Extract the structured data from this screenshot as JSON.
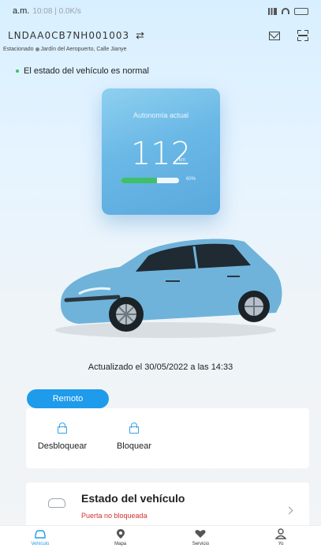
{
  "status_bar": {
    "time": "a.m.",
    "extra": "10:08 | 0.0K/s",
    "signal": ".ıll"
  },
  "header": {
    "vin": "LNDAA0CB7NH001003",
    "switch_glyph": "⇄"
  },
  "location": {
    "text": "Estacionado",
    "address": "Jardín del Aeropuerto, Calle Jianye"
  },
  "status_message": "El estado del vehículo es normal",
  "range": {
    "label": "Autonomía actual",
    "value": "112",
    "unit": "km",
    "percent_text": "60%",
    "battery_level": 0.62
  },
  "updated_text": "Actualizado el 30/05/2022 a las 14:33",
  "remote": {
    "tab_label": "Remoto",
    "controls": [
      {
        "label": "Desbloquear"
      },
      {
        "label": "Bloquear"
      }
    ]
  },
  "vehicle_state": {
    "title": "Estado del vehículo",
    "subtitle": "Puerta  no  bloqueada"
  },
  "nav": [
    {
      "label": "Vehículo",
      "icon": "car-icon",
      "active": true
    },
    {
      "label": "Mapa",
      "icon": "map-pin-icon",
      "active": false
    },
    {
      "label": "Servicio",
      "icon": "heart-icon",
      "active": false
    },
    {
      "label": "Yo",
      "icon": "person-icon",
      "active": false
    }
  ],
  "colors": {
    "accent": "#1e9bea",
    "card": "#6ab8e6",
    "warning": "#d23030",
    "ok": "#3fbf6a",
    "car_body": "#6fb3da"
  }
}
